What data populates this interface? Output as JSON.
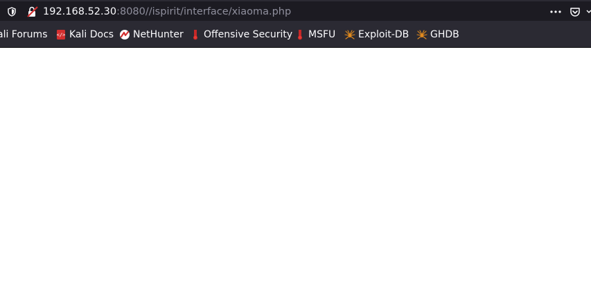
{
  "address_bar": {
    "url_host": "192.168.52.30",
    "url_rest": ":8080//ispirit/interface/xiaoma.php"
  },
  "bookmarks": [
    {
      "label": "ali Forums",
      "icon": "kali-forums-icon"
    },
    {
      "label": "Kali Docs",
      "icon": "kali-docs-icon"
    },
    {
      "label": "NetHunter",
      "icon": "nethunter-icon"
    },
    {
      "label": "Offensive Security",
      "icon": "offensive-security-icon"
    },
    {
      "label": "MSFU",
      "icon": "msfu-icon"
    },
    {
      "label": "Exploit-DB",
      "icon": "exploit-db-icon"
    },
    {
      "label": "GHDB",
      "icon": "ghdb-icon"
    }
  ],
  "colors": {
    "toolbar_bg": "#2b2a33",
    "urlbar_bg": "#1c1b22",
    "text_primary": "#fbfbfe",
    "text_muted": "#8f8f9d",
    "kali_red": "#d32f2f",
    "exploit_orange": "#e08a1e",
    "page_bg": "#ffffff"
  }
}
